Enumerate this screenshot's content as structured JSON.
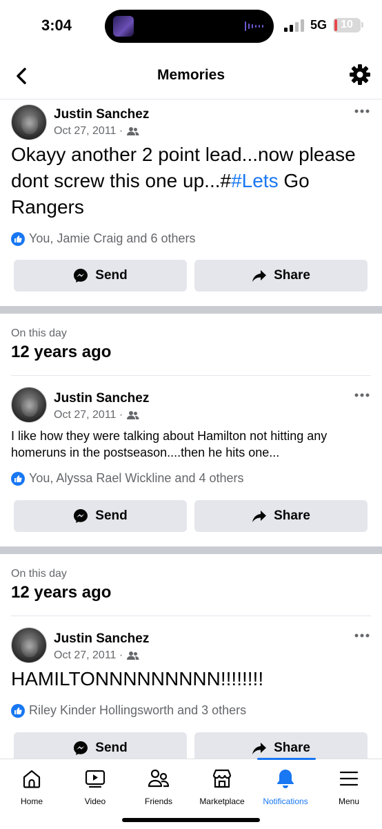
{
  "status_bar": {
    "time": "3:04",
    "network": "5G",
    "battery": "10",
    "battery_level": 0.1
  },
  "header": {
    "title": "Memories"
  },
  "posts": [
    {
      "author": "Justin Sanchez",
      "date": "Oct 27, 2011 ·",
      "text_before": "Okayy another 2 point lead...now please dont screw this one up...#",
      "hashtag": "#Lets",
      "text_after": " Go Rangers",
      "reactions": "You, Jamie Craig and 6 others",
      "send_label": "Send",
      "share_label": "Share"
    },
    {
      "on_this_day": "On this day",
      "years_ago": "12 years ago",
      "author": "Justin Sanchez",
      "date": "Oct 27, 2011 ·",
      "text": "I like how they were talking about Hamilton not hitting any homeruns in the postseason....then he hits one...",
      "reactions": "You, Alyssa Rael Wickline and 4 others",
      "send_label": "Send",
      "share_label": "Share"
    },
    {
      "on_this_day": "On this day",
      "years_ago": "12 years ago",
      "author": "Justin Sanchez",
      "date": "Oct 27, 2011 ·",
      "text": "HAMILTONNNNNNNNN!!!!!!!!",
      "reactions": "Riley Kinder Hollingsworth and 3 others",
      "send_label": "Send",
      "share_label": "Share"
    }
  ],
  "tabs": [
    {
      "label": "Home",
      "icon": "home-icon"
    },
    {
      "label": "Video",
      "icon": "video-icon"
    },
    {
      "label": "Friends",
      "icon": "friends-icon"
    },
    {
      "label": "Marketplace",
      "icon": "marketplace-icon"
    },
    {
      "label": "Notifications",
      "icon": "bell-icon",
      "active": true
    },
    {
      "label": "Menu",
      "icon": "menu-icon"
    }
  ],
  "colors": {
    "accent": "#1877f2",
    "button_bg": "#e4e6eb",
    "secondary_text": "#65676b",
    "battery_low": "#e5484d"
  }
}
